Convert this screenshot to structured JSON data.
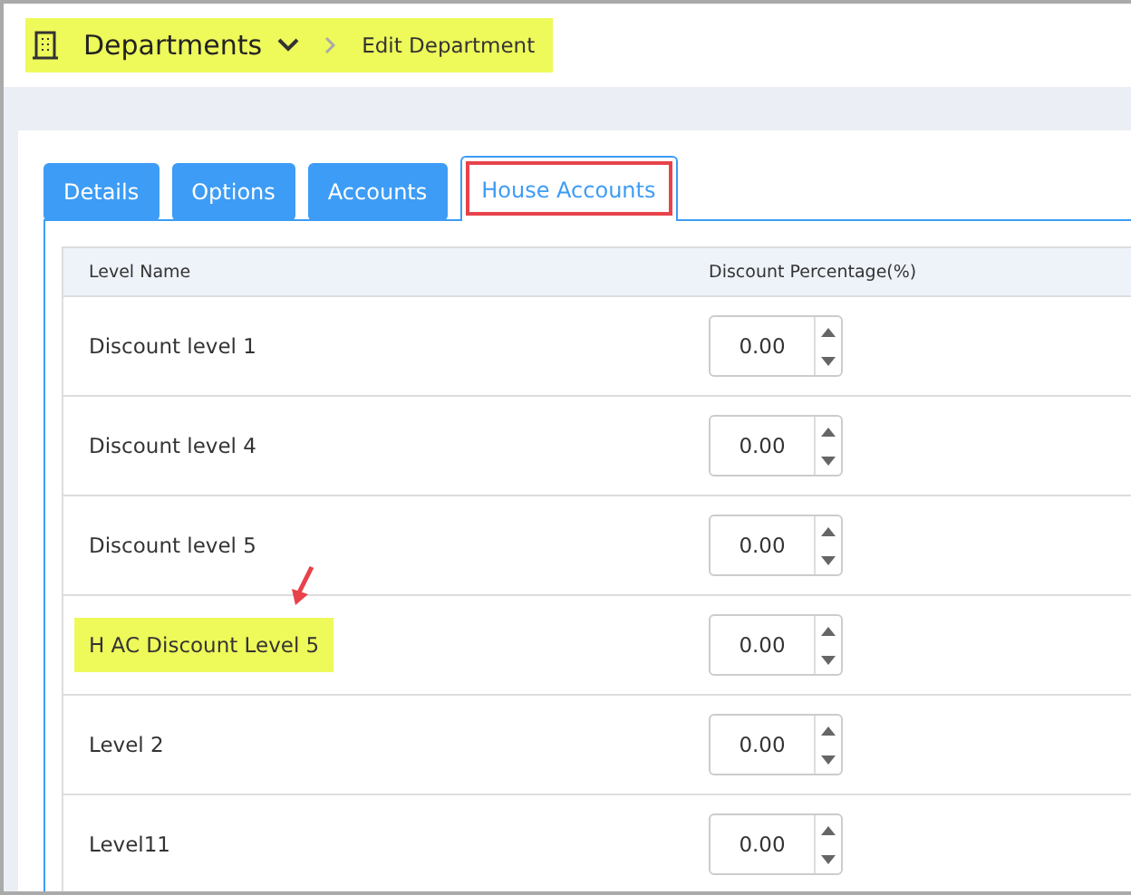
{
  "breadcrumb": {
    "title": "Departments",
    "current": "Edit Department",
    "highlighted": true
  },
  "tabs": [
    {
      "label": "Details",
      "selected": false,
      "annotated": false
    },
    {
      "label": "Options",
      "selected": false,
      "annotated": false
    },
    {
      "label": "Accounts",
      "selected": false,
      "annotated": false
    },
    {
      "label": "House Accounts",
      "selected": true,
      "annotated": true
    }
  ],
  "table": {
    "columns": [
      "Level Name",
      "Discount Percentage(%)"
    ],
    "rows": [
      {
        "name": "Discount level 1",
        "value": "0.00",
        "highlighted": false
      },
      {
        "name": "Discount level 4",
        "value": "0.00",
        "highlighted": false
      },
      {
        "name": "Discount level 5",
        "value": "0.00",
        "highlighted": false
      },
      {
        "name": "H AC Discount Level 5",
        "value": "0.00",
        "highlighted": true
      },
      {
        "name": "Level 2",
        "value": "0.00",
        "highlighted": false
      },
      {
        "name": "Level11",
        "value": "0.00",
        "highlighted": false
      }
    ]
  }
}
